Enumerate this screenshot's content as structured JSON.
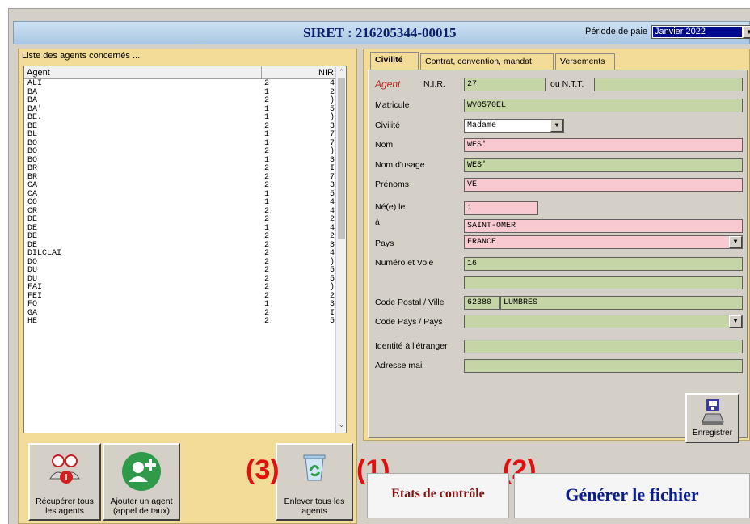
{
  "header": {
    "siret": "SIRET : 216205344-00015",
    "periode_label": "Période de paie",
    "periode_value": "Janvier 2022"
  },
  "agent_list": {
    "caption": "Liste des agents concernés ...",
    "col_agent": "Agent",
    "col_nir": "NIR",
    "rows": [
      {
        "name": "ALI",
        "nir": "2",
        "tail": "4"
      },
      {
        "name": "BA",
        "nir": "1",
        "tail": "2"
      },
      {
        "name": "BA",
        "nir": "2",
        "tail": ")"
      },
      {
        "name": "BA'",
        "nir": "1",
        "tail": "5"
      },
      {
        "name": "BE.",
        "nir": "1",
        "tail": ")"
      },
      {
        "name": "BE",
        "nir": "2",
        "tail": "3"
      },
      {
        "name": "BL",
        "nir": "1",
        "tail": "7"
      },
      {
        "name": "BO",
        "nir": "1",
        "tail": "7"
      },
      {
        "name": "BO",
        "nir": "2",
        "tail": ")"
      },
      {
        "name": "BO",
        "nir": "1",
        "tail": "3"
      },
      {
        "name": "BR",
        "nir": "2",
        "tail": "I"
      },
      {
        "name": "BR",
        "nir": "2",
        "tail": "7"
      },
      {
        "name": "CA",
        "nir": "2",
        "tail": "3"
      },
      {
        "name": "CA",
        "nir": "1",
        "tail": "5"
      },
      {
        "name": "CO",
        "nir": "1",
        "tail": "4"
      },
      {
        "name": "CR",
        "nir": "2",
        "tail": "4"
      },
      {
        "name": "DE",
        "nir": "2",
        "tail": "2"
      },
      {
        "name": "DE",
        "nir": "1",
        "tail": "4"
      },
      {
        "name": "DE",
        "nir": "2",
        "tail": "2"
      },
      {
        "name": "DE",
        "nir": "2",
        "tail": "3"
      },
      {
        "name": "DILCLAI",
        "nir": "2",
        "tail": "4"
      },
      {
        "name": "DO",
        "nir": "2",
        "tail": ")"
      },
      {
        "name": "DU",
        "nir": "2",
        "tail": "5"
      },
      {
        "name": "DU",
        "nir": "2",
        "tail": "5"
      },
      {
        "name": "FAI",
        "nir": "2",
        "tail": ")"
      },
      {
        "name": "FEI",
        "nir": "2",
        "tail": "2"
      },
      {
        "name": "FO",
        "nir": "1",
        "tail": "3"
      },
      {
        "name": "GA",
        "nir": "2",
        "tail": "I"
      },
      {
        "name": "HE",
        "nir": "2",
        "tail": "5"
      }
    ]
  },
  "left_buttons": {
    "recuperer": "Récupérer tous les agents",
    "ajouter": "Ajouter un agent (appel de taux)",
    "enlever": "Enlever tous les agents"
  },
  "annotations": {
    "a1": "(1)",
    "a2": "(2)",
    "a3": "(3)"
  },
  "tabs": [
    "Civilité",
    "Contrat, convention, mandat",
    "Versements"
  ],
  "form": {
    "agent_label": "Agent",
    "nir_label": "N.I.R.",
    "nir_value": "27",
    "ntt_label": "ou N.T.T.",
    "matricule_label": "Matricule",
    "matricule_value": "WV0570EL",
    "civilite_label": "Civilité",
    "civilite_value": "Madame",
    "nom_label": "Nom",
    "nom_value": "WES'",
    "nom_usage_label": "Nom d'usage",
    "nom_usage_value": "WES'",
    "prenoms_label": "Prénoms",
    "prenoms_value": "VE",
    "ne_label": "Né(e) le",
    "ne_value": "1",
    "a_label": "à",
    "a_value": "SAINT-OMER",
    "pays_label": "Pays",
    "pays_value": "FRANCE",
    "voie_label": "Numéro et Voie",
    "voie_value": "16",
    "cp_label": "Code Postal / Ville",
    "cp_value": "62380",
    "ville_value": "LUMBRES",
    "code_pays_label": "Code Pays / Pays",
    "etranger_label": "Identité à l'étranger",
    "mail_label": "Adresse mail",
    "save_label": "Enregistrer"
  },
  "actions": {
    "etats": "Etats de contrôle",
    "generer": "Générer le fichier"
  }
}
